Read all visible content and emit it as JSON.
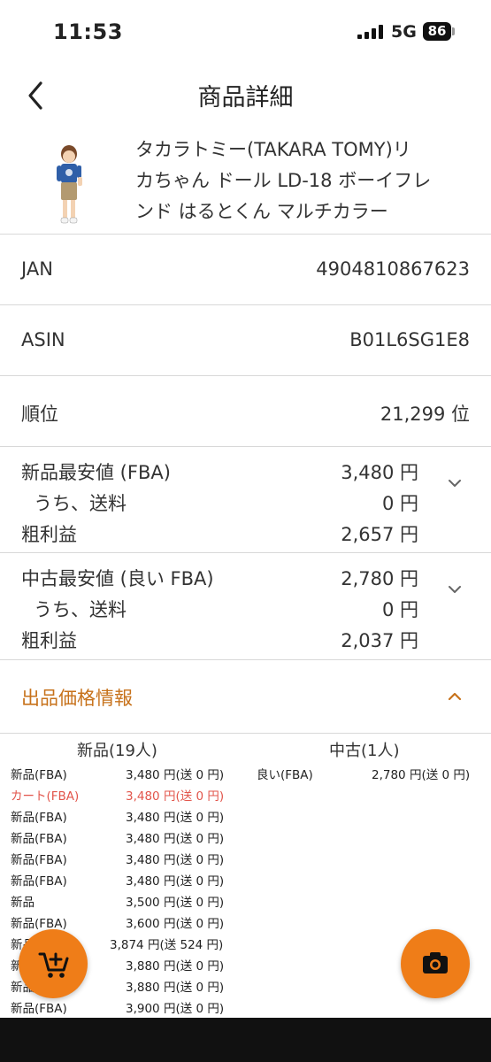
{
  "status_bar": {
    "time": "11:53",
    "network": "5G",
    "battery": "86"
  },
  "nav": {
    "title": "商品詳細"
  },
  "product": {
    "name_lines": [
      "タカラトミー(TAKARA TOMY)リ",
      "カちゃん ドール LD-18 ボーイフレ",
      "ンド はるとくん マルチカラー"
    ]
  },
  "info_rows": [
    {
      "label": "JAN",
      "value": "4904810867623"
    },
    {
      "label": "ASIN",
      "value": "B01L6SG1E8"
    },
    {
      "label": "順位",
      "value": "21,299 位"
    }
  ],
  "new_price": {
    "title": "新品最安値 (FBA)",
    "title_value": "3,480 円",
    "shipping_label": "うち、送料",
    "shipping_value": "0 円",
    "profit_label": "粗利益",
    "profit_value": "2,657 円"
  },
  "used_price": {
    "title": "中古最安値 (良い FBA)",
    "title_value": "2,780 円",
    "shipping_label": "うち、送料",
    "shipping_value": "0 円",
    "profit_label": "粗利益",
    "profit_value": "2,037 円"
  },
  "listing_section": {
    "title": "出品価格情報"
  },
  "offers": {
    "new_header": "新品(19人)",
    "used_header": "中古(1人)",
    "new": [
      {
        "cond": "新品(FBA)",
        "price": "3,480 円(送 0 円)"
      },
      {
        "cond": "カート(FBA)",
        "price": "3,480 円(送 0 円)",
        "highlight": true
      },
      {
        "cond": "新品(FBA)",
        "price": "3,480 円(送 0 円)"
      },
      {
        "cond": "新品(FBA)",
        "price": "3,480 円(送 0 円)"
      },
      {
        "cond": "新品(FBA)",
        "price": "3,480 円(送 0 円)"
      },
      {
        "cond": "新品(FBA)",
        "price": "3,480 円(送 0 円)"
      },
      {
        "cond": "新品",
        "price": "3,500 円(送 0 円)"
      },
      {
        "cond": "新品(FBA)",
        "price": "3,600 円(送 0 円)"
      },
      {
        "cond": "新品",
        "price": "3,874 円(送 524 円)"
      },
      {
        "cond": "新品",
        "price": "3,880 円(送 0 円)"
      },
      {
        "cond": "新品",
        "price": "3,880 円(送 0 円)"
      },
      {
        "cond": "新品(FBA)",
        "price": "3,900 円(送 0 円)"
      }
    ],
    "used": [
      {
        "cond": "良い(FBA)",
        "price": "2,780 円(送 0 円)"
      }
    ]
  },
  "fabs": {
    "cart_icon": "add-cart-icon",
    "camera_icon": "camera-icon"
  },
  "colors": {
    "accent": "#ef7d18",
    "section_title": "#c7721b",
    "cart_highlight": "#e2554b"
  }
}
